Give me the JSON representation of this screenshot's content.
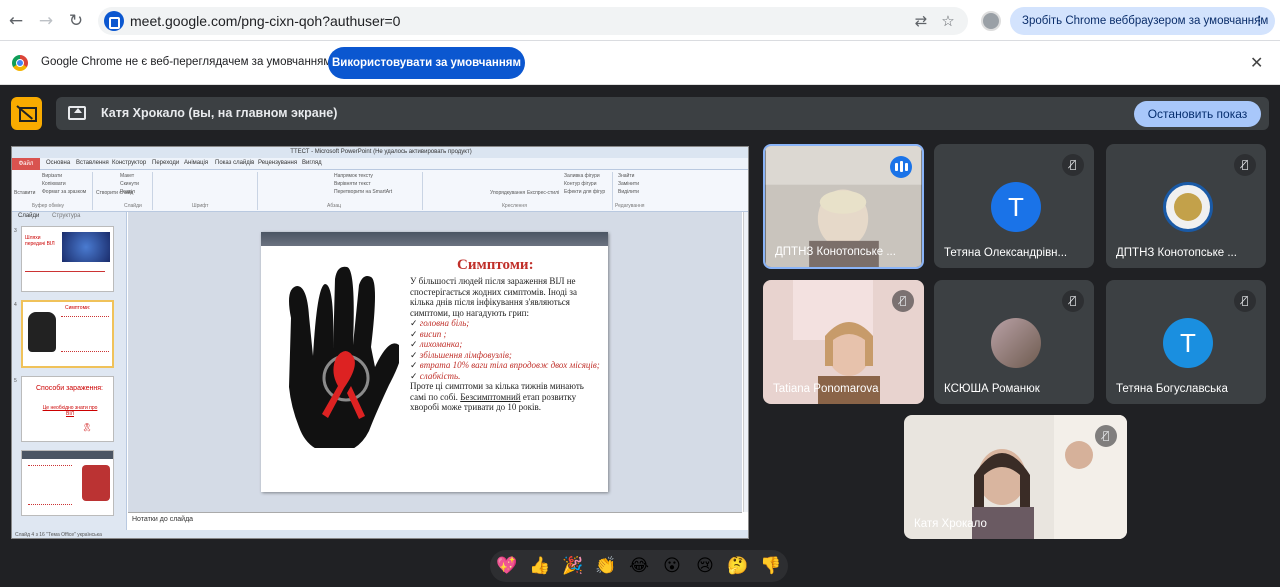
{
  "browser": {
    "url": "meet.google.com/png-cixn-qoh?authuser=0",
    "default_prompt": "Зробіть Chrome веббраузером за умовчанням"
  },
  "infobar": {
    "text": "Google Chrome не є веб-переглядачем за умовчанням",
    "button": "Використовувати за умовчанням"
  },
  "presenting": {
    "label": "Катя Хрокало (вы, на главном экране)",
    "stop_button": "Остановить показ"
  },
  "powerpoint": {
    "window_title": "ТТЕСТ - Microsoft PowerPoint (Не удалось активировать продукт)",
    "file_tab": "Файл",
    "tabs": [
      "Основна",
      "Вставлення",
      "Конструктор",
      "Переходи",
      "Анімація",
      "Показ слайдів",
      "Рецензування",
      "Вигляд"
    ],
    "ribbon_groups": [
      "Буфер обміну",
      "Слайди",
      "Шрифт",
      "Абзац",
      "Креслення",
      "Редагування"
    ],
    "ribbon_items": [
      "Вирізати",
      "Копіювати",
      "Формат за зразком",
      "Макет",
      "Скинути",
      "Розділ",
      "Створити слайд",
      "Вставити",
      "Знайти",
      "Замінити",
      "Виділити",
      "Упорядкування",
      "Експрес-стилі",
      "Заливка фігури",
      "Контур фігури",
      "Ефекти для фігур",
      "Напрямок тексту",
      "Вирівняти текст",
      "Перетворити на SmartArt"
    ],
    "left_tabs": [
      "Слайди",
      "Структура"
    ],
    "thumbs": [
      {
        "num": "3",
        "text": "Шляхи передачі ВІЛ"
      },
      {
        "num": "4",
        "text": "Симптоми:"
      },
      {
        "num": "5",
        "text": "Способи зараження:"
      },
      {
        "num": "6",
        "text": "Це необхідно знати про ВІЛ"
      }
    ],
    "slide": {
      "title": "Симптоми:",
      "intro": "У більшості людей після зараження ВІЛ не спостерігається жодних симптомів. Іноді за кілька днів після інфікування з'являються симптоми, що нагадують грип:",
      "symptoms": [
        "головна біль;",
        "висип ;",
        "лихоманка;",
        "збільшення лімфовузлів;",
        "втрата 10% ваги тіла впродовж двох місяців;",
        "слабкість."
      ],
      "outro_1": "Проте ці симптоми за кілька тижнів минають самі по собі. ",
      "outro_underlined": "Безсимптомний",
      "outro_2": " етап розвитку хворобі може тривати до 10 років."
    },
    "notes_placeholder": "Нотатки до слайда",
    "status": "Слайд 4 з 16    \"Тема Office\"    українська"
  },
  "participants": [
    {
      "name": "ДПТНЗ Конотопське ...",
      "speaking": true
    },
    {
      "name": "Тетяна Олександрівн...",
      "avatar_letter": "T",
      "avatar_color": "#1a73e8",
      "muted": true
    },
    {
      "name": "ДПТНЗ Конотопське ...",
      "muted": true
    },
    {
      "name": "Tatiana Ponomarova",
      "muted": true
    },
    {
      "name": "КСЮША Романюк",
      "muted": true
    },
    {
      "name": "Тетяна Богуславська",
      "avatar_letter": "T",
      "avatar_color": "#1a73e8",
      "muted": true
    },
    {
      "name": "Катя Хрокало",
      "muted": true
    }
  ],
  "reactions": [
    "💖",
    "👍",
    "🎉",
    "👏",
    "😂",
    "😮",
    "😢",
    "🤔",
    "👎"
  ]
}
